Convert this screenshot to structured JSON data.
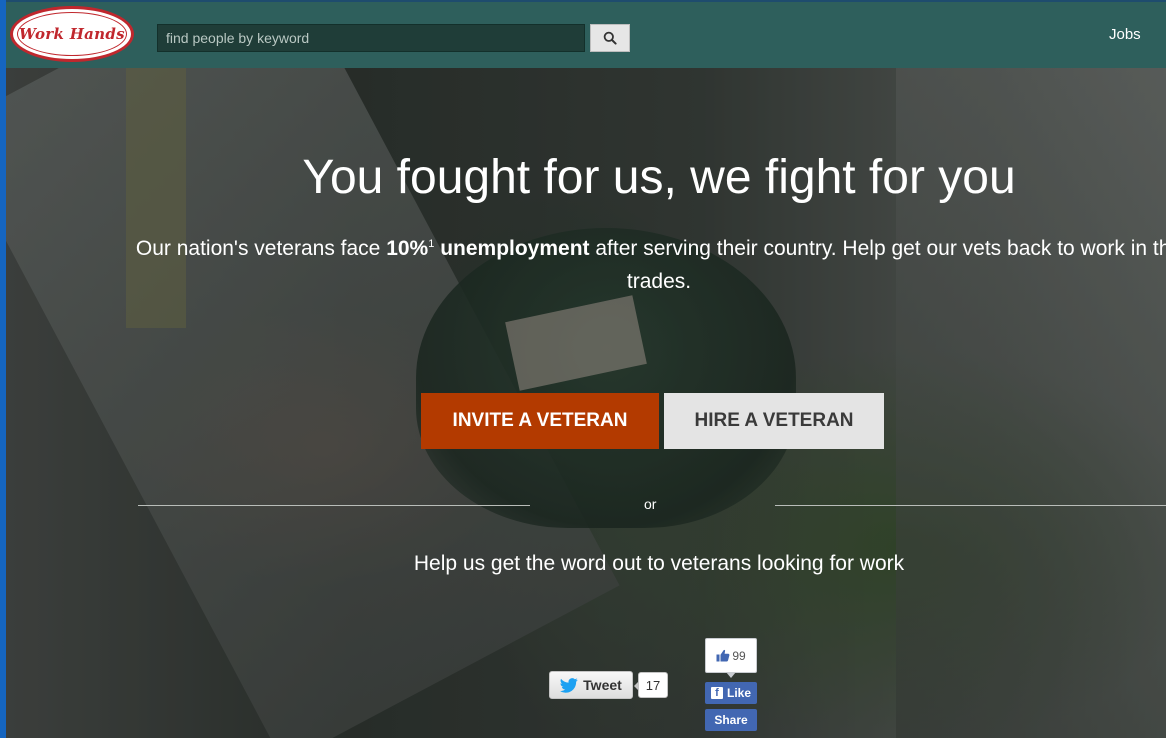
{
  "header": {
    "logo_text": "Work Hands",
    "search": {
      "placeholder": "find people by keyword",
      "value": ""
    },
    "nav_jobs": "Jobs"
  },
  "hero": {
    "title": "You fought for us, we fight for you",
    "subtitle_before": "Our nation's veterans face ",
    "subtitle_stat": "10%",
    "subtitle_footnote": "1",
    "subtitle_bold_word": "unemployment",
    "subtitle_after": " after serving their country. Help get our vets back to work in the trades.",
    "invite_button": "INVITE A VETERAN",
    "hire_button": "HIRE A VETERAN",
    "or_text": "or",
    "help_text": "Help us get the word out to veterans looking for work"
  },
  "social": {
    "tweet_label": "Tweet",
    "tweet_count": "17",
    "fb_like_count": "99",
    "fb_like_label": "Like",
    "fb_share_label": "Share"
  },
  "colors": {
    "navbar": "#2e5f5c",
    "invite_button": "#b33a00",
    "hire_button": "#e4e4e4",
    "facebook": "#4267b2",
    "twitter": "#1da1f2",
    "logo_red": "#c0272d"
  }
}
